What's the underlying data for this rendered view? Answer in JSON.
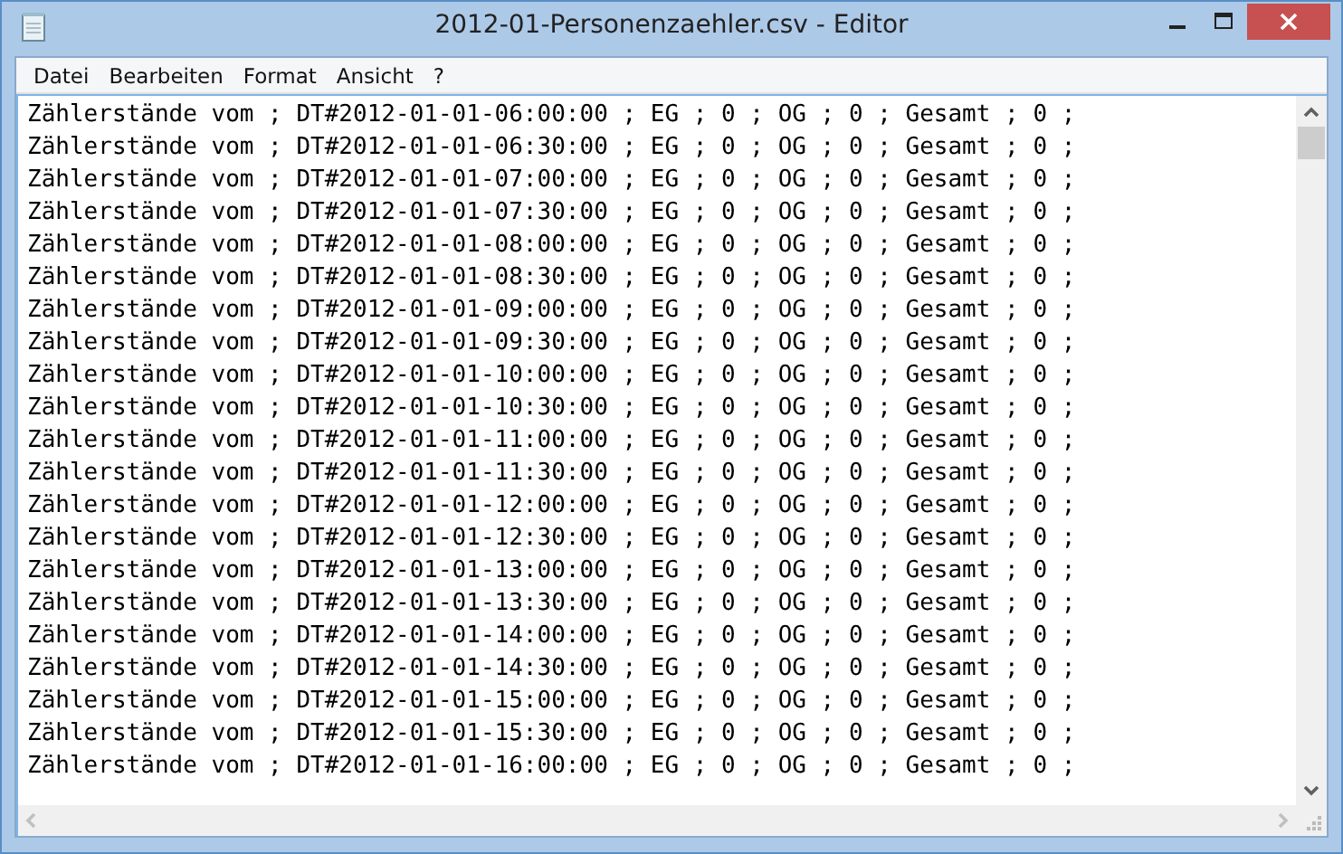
{
  "window": {
    "title": "2012-01-Personenzaehler.csv - Editor"
  },
  "menu": [
    "Datei",
    "Bearbeiten",
    "Format",
    "Ansicht",
    "?"
  ],
  "lines": [
    "Zählerstände vom ; DT#2012-01-01-06:00:00 ; EG ; 0 ; OG ; 0 ; Gesamt ; 0 ;",
    "Zählerstände vom ; DT#2012-01-01-06:30:00 ; EG ; 0 ; OG ; 0 ; Gesamt ; 0 ;",
    "Zählerstände vom ; DT#2012-01-01-07:00:00 ; EG ; 0 ; OG ; 0 ; Gesamt ; 0 ;",
    "Zählerstände vom ; DT#2012-01-01-07:30:00 ; EG ; 0 ; OG ; 0 ; Gesamt ; 0 ;",
    "Zählerstände vom ; DT#2012-01-01-08:00:00 ; EG ; 0 ; OG ; 0 ; Gesamt ; 0 ;",
    "Zählerstände vom ; DT#2012-01-01-08:30:00 ; EG ; 0 ; OG ; 0 ; Gesamt ; 0 ;",
    "Zählerstände vom ; DT#2012-01-01-09:00:00 ; EG ; 0 ; OG ; 0 ; Gesamt ; 0 ;",
    "Zählerstände vom ; DT#2012-01-01-09:30:00 ; EG ; 0 ; OG ; 0 ; Gesamt ; 0 ;",
    "Zählerstände vom ; DT#2012-01-01-10:00:00 ; EG ; 0 ; OG ; 0 ; Gesamt ; 0 ;",
    "Zählerstände vom ; DT#2012-01-01-10:30:00 ; EG ; 0 ; OG ; 0 ; Gesamt ; 0 ;",
    "Zählerstände vom ; DT#2012-01-01-11:00:00 ; EG ; 0 ; OG ; 0 ; Gesamt ; 0 ;",
    "Zählerstände vom ; DT#2012-01-01-11:30:00 ; EG ; 0 ; OG ; 0 ; Gesamt ; 0 ;",
    "Zählerstände vom ; DT#2012-01-01-12:00:00 ; EG ; 0 ; OG ; 0 ; Gesamt ; 0 ;",
    "Zählerstände vom ; DT#2012-01-01-12:30:00 ; EG ; 0 ; OG ; 0 ; Gesamt ; 0 ;",
    "Zählerstände vom ; DT#2012-01-01-13:00:00 ; EG ; 0 ; OG ; 0 ; Gesamt ; 0 ;",
    "Zählerstände vom ; DT#2012-01-01-13:30:00 ; EG ; 0 ; OG ; 0 ; Gesamt ; 0 ;",
    "Zählerstände vom ; DT#2012-01-01-14:00:00 ; EG ; 0 ; OG ; 0 ; Gesamt ; 0 ;",
    "Zählerstände vom ; DT#2012-01-01-14:30:00 ; EG ; 0 ; OG ; 0 ; Gesamt ; 0 ;",
    "Zählerstände vom ; DT#2012-01-01-15:00:00 ; EG ; 0 ; OG ; 0 ; Gesamt ; 0 ;",
    "Zählerstände vom ; DT#2012-01-01-15:30:00 ; EG ; 0 ; OG ; 0 ; Gesamt ; 0 ;",
    "Zählerstände vom ; DT#2012-01-01-16:00:00 ; EG ; 0 ; OG ; 0 ; Gesamt ; 0 ;"
  ]
}
